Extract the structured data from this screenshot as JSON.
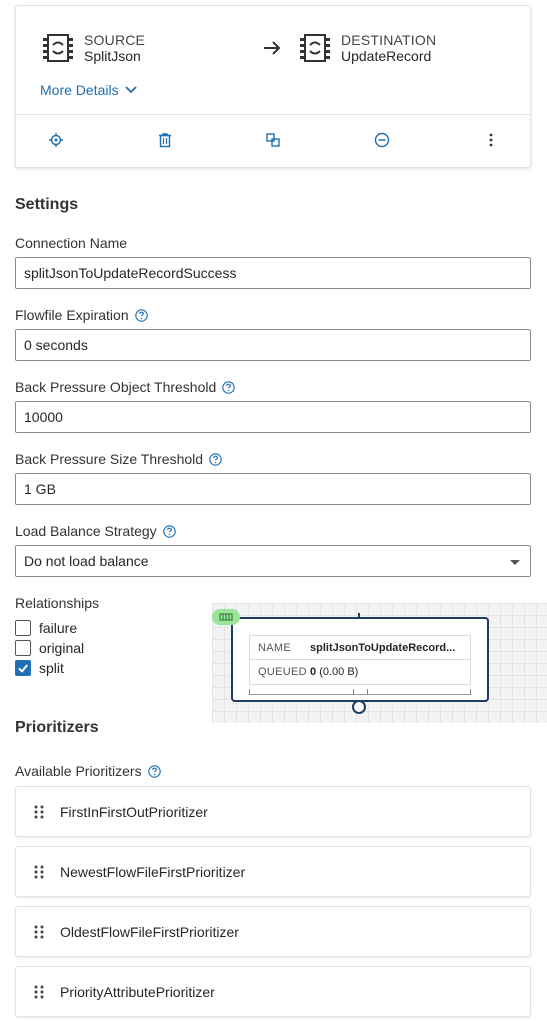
{
  "connection_card": {
    "source": {
      "kind": "SOURCE",
      "name": "SplitJson"
    },
    "destination": {
      "kind": "DESTINATION",
      "name": "UpdateRecord"
    },
    "more_details": "More Details",
    "actions": [
      "locate-icon",
      "delete-icon",
      "copy-icon",
      "remove-icon",
      "more-vertical-icon"
    ]
  },
  "settings": {
    "title": "Settings",
    "connection_name": {
      "label": "Connection Name",
      "value": "splitJsonToUpdateRecordSuccess"
    },
    "flowfile_expiration": {
      "label": "Flowfile Expiration",
      "value": "0 seconds"
    },
    "bp_object": {
      "label": "Back Pressure Object Threshold",
      "value": "10000"
    },
    "bp_size": {
      "label": "Back Pressure Size Threshold",
      "value": "1 GB"
    },
    "load_balance": {
      "label": "Load Balance Strategy",
      "value": "Do not load balance"
    }
  },
  "relationships": {
    "label": "Relationships",
    "items": [
      {
        "name": "failure",
        "checked": false
      },
      {
        "name": "original",
        "checked": false
      },
      {
        "name": "split",
        "checked": true
      }
    ]
  },
  "preview": {
    "name_key": "NAME",
    "name_value": "splitJsonToUpdateRecord...",
    "queued_key": "QUEUED",
    "queued_count": "0",
    "queued_size": "(0.00 B)"
  },
  "prioritizers": {
    "title": "Prioritizers",
    "available_label": "Available Prioritizers",
    "items": [
      "FirstInFirstOutPrioritizer",
      "NewestFlowFileFirstPrioritizer",
      "OldestFlowFileFirstPrioritizer",
      "PriorityAttributePrioritizer"
    ]
  },
  "colors": {
    "accent": "#1f6fb2",
    "border": "#8a8a8a",
    "connection": "#1f3b66",
    "badge": "#9be59b"
  }
}
